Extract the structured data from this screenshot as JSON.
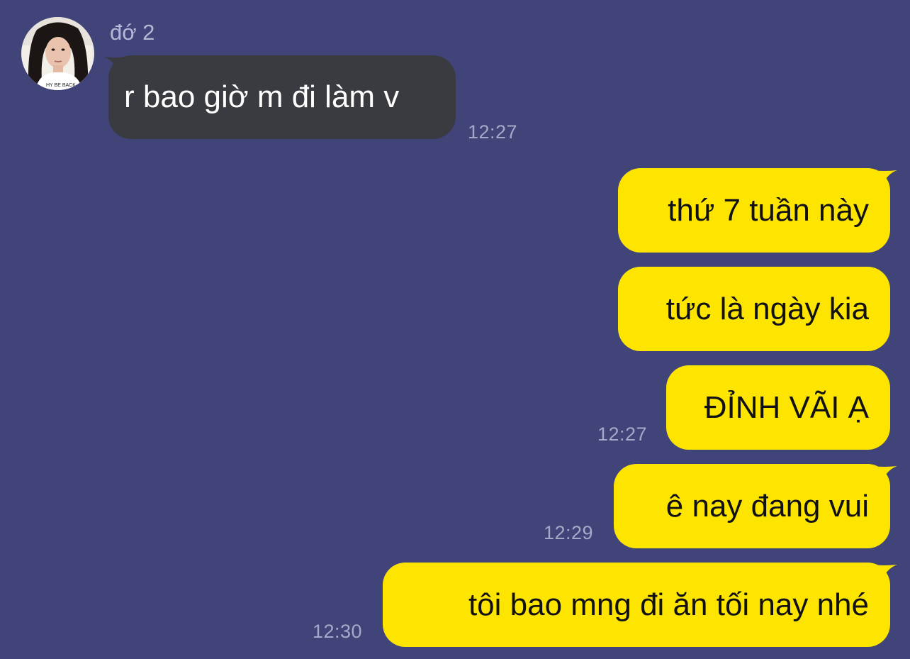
{
  "contact": {
    "name": "đớ 2",
    "avatar_caption": "HY BE BACK"
  },
  "colors": {
    "background": "#404478",
    "incoming_bubble": "#3a3b41",
    "outgoing_bubble": "#fde500",
    "timestamp": "#a6a8c8"
  },
  "messages": [
    {
      "direction": "incoming",
      "text": "r bao giờ m đi làm v",
      "time": "12:27"
    },
    {
      "direction": "outgoing",
      "text": "thứ 7 tuần này",
      "time": ""
    },
    {
      "direction": "outgoing",
      "text": "tức là ngày kia",
      "time": ""
    },
    {
      "direction": "outgoing",
      "text": "ĐỈNH VÃI Ạ",
      "time": "12:27"
    },
    {
      "direction": "outgoing",
      "text": "ê nay đang vui",
      "time": "12:29"
    },
    {
      "direction": "outgoing",
      "text": "tôi bao mng đi ăn tối nay nhé",
      "time": "12:30"
    }
  ]
}
